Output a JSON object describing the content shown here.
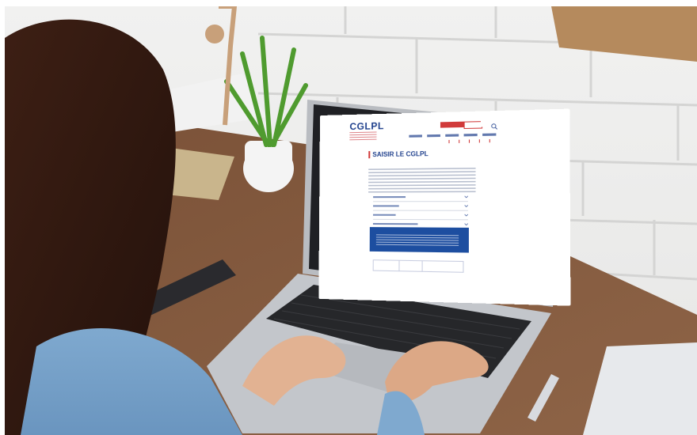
{
  "site": {
    "logo_text": "CGLPL",
    "page_title": "SAISIR LE CGLPL"
  },
  "colors": {
    "brand_blue": "#1e3f8c",
    "accent_red": "#d13a3a",
    "panel_blue": "#1d4ea0"
  },
  "icons": [
    "search-icon",
    "chevron-down-icon"
  ]
}
